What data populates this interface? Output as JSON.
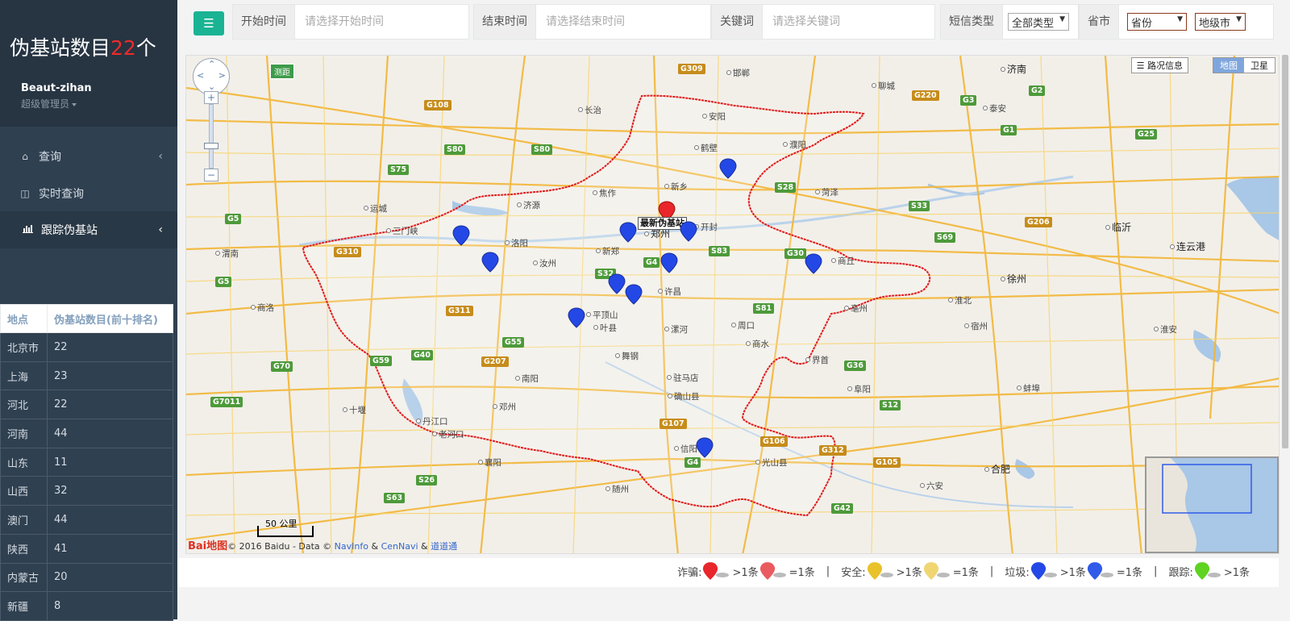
{
  "sidebar": {
    "title_prefix": "伪基站数目",
    "title_count": "22",
    "title_suffix": "个",
    "user_name": "Beaut-zihan",
    "user_role": "超级管理员",
    "menu": [
      {
        "icon": "home-icon",
        "label": "查询",
        "chevron": "‹"
      },
      {
        "icon": "columns-icon",
        "label": "实时查询"
      },
      {
        "icon": "bar-chart-icon",
        "label": "跟踪伪基站",
        "chevron": "‹"
      }
    ],
    "table": {
      "headers": [
        "地点",
        "伪基站数目(前十排名)"
      ],
      "rows": [
        [
          "北京市",
          "22"
        ],
        [
          "上海",
          "23"
        ],
        [
          "河北",
          "22"
        ],
        [
          "河南",
          "44"
        ],
        [
          "山东",
          "11"
        ],
        [
          "山西",
          "32"
        ],
        [
          "澳门",
          "44"
        ],
        [
          "陕西",
          "41"
        ],
        [
          "内蒙古",
          "20"
        ],
        [
          "新疆",
          "8"
        ]
      ]
    }
  },
  "filters": {
    "start_label": "开始时间",
    "start_placeholder": "请选择开始时间",
    "end_label": "结束时间",
    "end_placeholder": "请选择结束时间",
    "keyword_label": "关键词",
    "keyword_placeholder": "请选择关键词",
    "sms_type_label": "短信类型",
    "sms_type_value": "全部类型",
    "region_label": "省市",
    "province_value": "省份",
    "city_value": "地级市"
  },
  "map": {
    "latest_label": "最新伪基站",
    "ranging_label": "测距",
    "traffic_label": "路况信息",
    "maptype_map": "地图",
    "maptype_satellite": "卫星",
    "scale_label": "50 公里",
    "copyright_prefix": "Bai",
    "copyright_brand": "地图",
    "copyright_text": "© 2016 Baidu - Data © ",
    "copyright_nav": "NavInfo",
    "copyright_amp1": " & ",
    "copyright_cen": "CenNavi",
    "copyright_amp2": " & ",
    "copyright_dao": "道道通",
    "cities": [
      {
        "name": "郑州",
        "big": true
      },
      {
        "name": "洛阳"
      },
      {
        "name": "开封"
      },
      {
        "name": "新郑"
      },
      {
        "name": "许昌"
      },
      {
        "name": "平顶山"
      },
      {
        "name": "漯河"
      },
      {
        "name": "周口"
      },
      {
        "name": "商丘"
      },
      {
        "name": "驻马店"
      },
      {
        "name": "信阳"
      },
      {
        "name": "南阳"
      },
      {
        "name": "三门峡"
      },
      {
        "name": "焦作"
      },
      {
        "name": "新乡"
      },
      {
        "name": "鹤壁"
      },
      {
        "name": "安阳"
      },
      {
        "name": "濮阳"
      },
      {
        "name": "济源"
      },
      {
        "name": "邯郸"
      },
      {
        "name": "长治"
      },
      {
        "name": "运城"
      },
      {
        "name": "菏泽"
      },
      {
        "name": "徐州"
      },
      {
        "name": "亳州"
      },
      {
        "name": "阜阳"
      },
      {
        "name": "合肥"
      },
      {
        "name": "襄阳"
      },
      {
        "name": "十堰"
      },
      {
        "name": "随州"
      },
      {
        "name": "渭南"
      },
      {
        "name": "商洛"
      },
      {
        "name": "淮北"
      },
      {
        "name": "宿州"
      },
      {
        "name": "蚌埠"
      },
      {
        "name": "济南"
      },
      {
        "name": "泰安"
      },
      {
        "name": "聊城"
      },
      {
        "name": "临沂"
      },
      {
        "name": "连云港"
      },
      {
        "name": "淮安"
      },
      {
        "name": "六安"
      },
      {
        "name": "光山县"
      },
      {
        "name": "叶县"
      },
      {
        "name": "汝州"
      },
      {
        "name": "舞钢"
      },
      {
        "name": "确山县"
      },
      {
        "name": "邓州"
      },
      {
        "name": "丹江口"
      },
      {
        "name": "老河口"
      },
      {
        "name": "商水"
      },
      {
        "name": "界首"
      }
    ],
    "shields": [
      "G4",
      "G30",
      "S83",
      "S32",
      "G311",
      "G310",
      "G55",
      "G40",
      "G59",
      "G70",
      "S81",
      "G36",
      "S12",
      "G105",
      "G106",
      "G312",
      "G42",
      "G107",
      "G5",
      "G2",
      "G3",
      "G25",
      "G1",
      "S28",
      "S33",
      "S69",
      "G206",
      "G220",
      "G309",
      "G108",
      "G207",
      "S80",
      "S75",
      "S80",
      "G5",
      "G7011",
      "S26",
      "S63",
      "G4"
    ]
  },
  "legend": {
    "fraud_label": "诈骗:",
    "security_label": "安全:",
    "spam_label": "垃圾:",
    "track_label": "跟踪:",
    "gt1": ">1条",
    "eq1": "=1条",
    "separator": "|",
    "colors": {
      "fraud": "#e8262b",
      "fraud_single": "#ea5b60",
      "security": "#e9c22a",
      "security_single": "#efd672",
      "spam": "#2348e6",
      "spam_single": "#2f5be8",
      "track": "#5ed321"
    }
  },
  "colors": {
    "accent": "#1ab394",
    "sidebar": "#2f4050",
    "count_red": "#ed2b2b",
    "border_red": "#e11b1b"
  }
}
